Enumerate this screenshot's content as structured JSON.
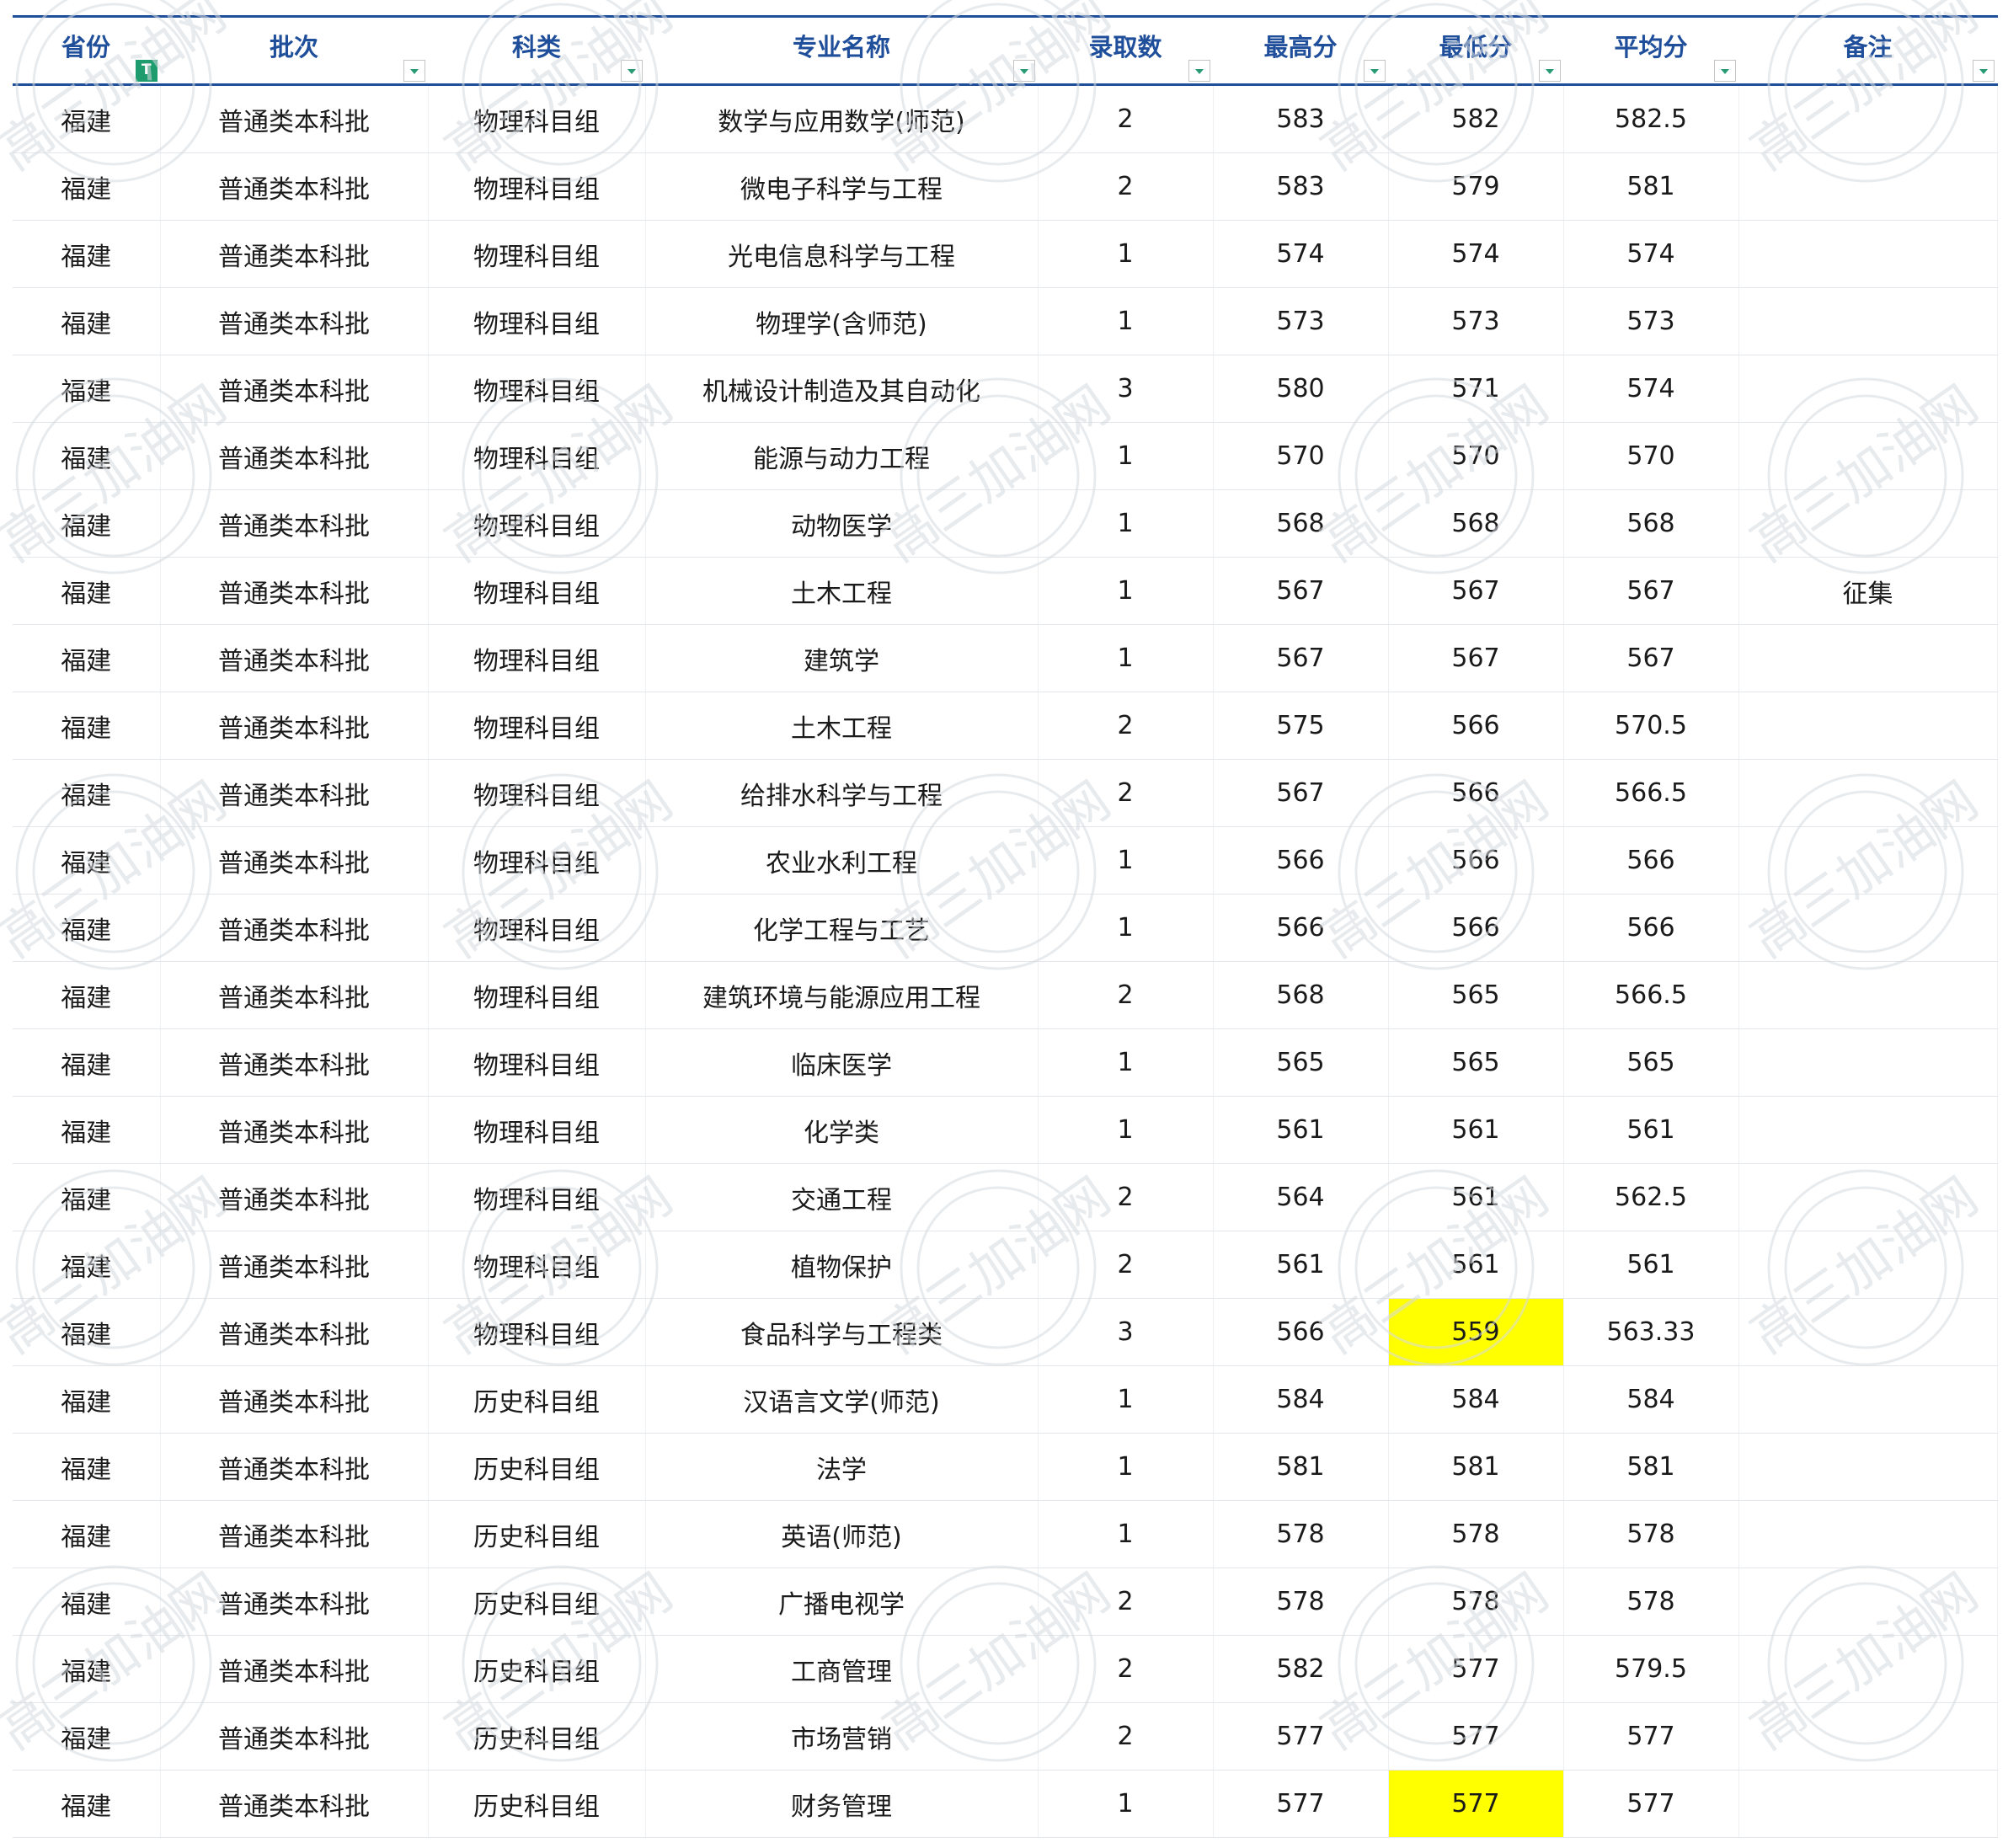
{
  "table": {
    "headers": [
      "省份",
      "批次",
      "科类",
      "专业名称",
      "录取数",
      "最高分",
      "最低分",
      "平均分",
      "备注"
    ],
    "header_filters": [
      "active",
      "dropdown",
      "dropdown",
      "dropdown",
      "dropdown",
      "dropdown",
      "dropdown",
      "dropdown",
      "dropdown"
    ],
    "highlight_color": "#ffff00",
    "header_color": "#1f4e9a",
    "rows": [
      [
        "福建",
        "普通类本科批",
        "物理科目组",
        "数学与应用数学(师范)",
        "2",
        "583",
        "582",
        "582.5",
        ""
      ],
      [
        "福建",
        "普通类本科批",
        "物理科目组",
        "微电子科学与工程",
        "2",
        "583",
        "579",
        "581",
        ""
      ],
      [
        "福建",
        "普通类本科批",
        "物理科目组",
        "光电信息科学与工程",
        "1",
        "574",
        "574",
        "574",
        ""
      ],
      [
        "福建",
        "普通类本科批",
        "物理科目组",
        "物理学(含师范)",
        "1",
        "573",
        "573",
        "573",
        ""
      ],
      [
        "福建",
        "普通类本科批",
        "物理科目组",
        "机械设计制造及其自动化",
        "3",
        "580",
        "571",
        "574",
        ""
      ],
      [
        "福建",
        "普通类本科批",
        "物理科目组",
        "能源与动力工程",
        "1",
        "570",
        "570",
        "570",
        ""
      ],
      [
        "福建",
        "普通类本科批",
        "物理科目组",
        "动物医学",
        "1",
        "568",
        "568",
        "568",
        ""
      ],
      [
        "福建",
        "普通类本科批",
        "物理科目组",
        "土木工程",
        "1",
        "567",
        "567",
        "567",
        "征集"
      ],
      [
        "福建",
        "普通类本科批",
        "物理科目组",
        "建筑学",
        "1",
        "567",
        "567",
        "567",
        ""
      ],
      [
        "福建",
        "普通类本科批",
        "物理科目组",
        "土木工程",
        "2",
        "575",
        "566",
        "570.5",
        ""
      ],
      [
        "福建",
        "普通类本科批",
        "物理科目组",
        "给排水科学与工程",
        "2",
        "567",
        "566",
        "566.5",
        ""
      ],
      [
        "福建",
        "普通类本科批",
        "物理科目组",
        "农业水利工程",
        "1",
        "566",
        "566",
        "566",
        ""
      ],
      [
        "福建",
        "普通类本科批",
        "物理科目组",
        "化学工程与工艺",
        "1",
        "566",
        "566",
        "566",
        ""
      ],
      [
        "福建",
        "普通类本科批",
        "物理科目组",
        "建筑环境与能源应用工程",
        "2",
        "568",
        "565",
        "566.5",
        ""
      ],
      [
        "福建",
        "普通类本科批",
        "物理科目组",
        "临床医学",
        "1",
        "565",
        "565",
        "565",
        ""
      ],
      [
        "福建",
        "普通类本科批",
        "物理科目组",
        "化学类",
        "1",
        "561",
        "561",
        "561",
        ""
      ],
      [
        "福建",
        "普通类本科批",
        "物理科目组",
        "交通工程",
        "2",
        "564",
        "561",
        "562.5",
        ""
      ],
      [
        "福建",
        "普通类本科批",
        "物理科目组",
        "植物保护",
        "2",
        "561",
        "561",
        "561",
        ""
      ],
      [
        "福建",
        "普通类本科批",
        "物理科目组",
        "食品科学与工程类",
        "3",
        "566",
        "559",
        "563.33",
        ""
      ],
      [
        "福建",
        "普通类本科批",
        "历史科目组",
        "汉语言文学(师范)",
        "1",
        "584",
        "584",
        "584",
        ""
      ],
      [
        "福建",
        "普通类本科批",
        "历史科目组",
        "法学",
        "1",
        "581",
        "581",
        "581",
        ""
      ],
      [
        "福建",
        "普通类本科批",
        "历史科目组",
        "英语(师范)",
        "1",
        "578",
        "578",
        "578",
        ""
      ],
      [
        "福建",
        "普通类本科批",
        "历史科目组",
        "广播电视学",
        "2",
        "578",
        "578",
        "578",
        ""
      ],
      [
        "福建",
        "普通类本科批",
        "历史科目组",
        "工商管理",
        "2",
        "582",
        "577",
        "579.5",
        ""
      ],
      [
        "福建",
        "普通类本科批",
        "历史科目组",
        "市场营销",
        "2",
        "577",
        "577",
        "577",
        ""
      ],
      [
        "福建",
        "普通类本科批",
        "历史科目组",
        "财务管理",
        "1",
        "577",
        "577",
        "577",
        ""
      ]
    ],
    "highlighted_cells": [
      [
        18,
        6
      ],
      [
        25,
        6
      ]
    ]
  },
  "watermark": {
    "text": "高三加油网",
    "color": "#d7dbe0"
  }
}
